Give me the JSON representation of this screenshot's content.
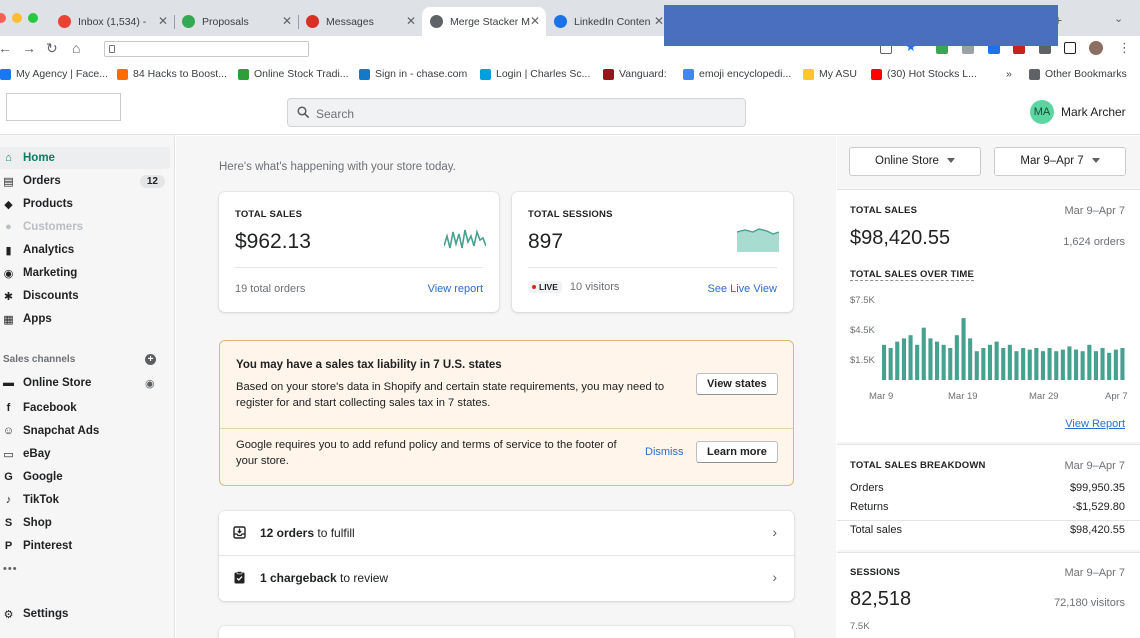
{
  "browser": {
    "tabs": [
      {
        "title": "Inbox (1,534) - ",
        "favicon_color": "#ea4335"
      },
      {
        "title": "Proposals",
        "favicon_color": "#34a853"
      },
      {
        "title": "Messages",
        "favicon_color": "#d93025"
      },
      {
        "title": "Merge Stacker M",
        "favicon_color": "#5f6368"
      },
      {
        "title": "LinkedIn Conten",
        "favicon_color": "#1a73e8"
      }
    ],
    "bookmarks": [
      {
        "label": "My Agency | Face...",
        "icon_color": "#1877f2"
      },
      {
        "label": "84 Hacks to Boost...",
        "icon_color": "#ff6b00"
      },
      {
        "label": "Online Stock Tradi...",
        "icon_color": "#2e9e3a"
      },
      {
        "label": "Sign in - chase.com",
        "icon_color": "#117aca"
      },
      {
        "label": "Login | Charles Sc...",
        "icon_color": "#00a0df"
      },
      {
        "label": "Vanguard:",
        "icon_color": "#96151d"
      },
      {
        "label": "emoji encyclopedi...",
        "icon_color": "#4285f4"
      },
      {
        "label": "My ASU",
        "icon_color": "#ffc627"
      },
      {
        "label": "(30) Hot Stocks L...",
        "icon_color": "#ff0000"
      },
      {
        "label": "Other Bookmarks",
        "icon_color": "#5f6368"
      }
    ],
    "overflow": "»"
  },
  "topbar": {
    "search_placeholder": "Search",
    "user_initials": "MA",
    "user_name": "Mark Archer"
  },
  "sidebar": {
    "items": [
      {
        "label": "Home",
        "icon": "home-icon",
        "glyph": "⌂"
      },
      {
        "label": "Orders",
        "icon": "orders-icon",
        "glyph": "▤",
        "count": "12"
      },
      {
        "label": "Products",
        "icon": "tag-icon",
        "glyph": "◆"
      },
      {
        "label": "Customers",
        "icon": "customer-icon",
        "glyph": "●"
      },
      {
        "label": "Analytics",
        "icon": "analytics-icon",
        "glyph": "▮"
      },
      {
        "label": "Marketing",
        "icon": "marketing-icon",
        "glyph": "◉"
      },
      {
        "label": "Discounts",
        "icon": "discount-icon",
        "glyph": "✱"
      },
      {
        "label": "Apps",
        "icon": "apps-icon",
        "glyph": "▦"
      }
    ],
    "channels_heading": "Sales channels",
    "channels": [
      {
        "label": "Online Store",
        "icon": "store-icon",
        "glyph": "▬"
      },
      {
        "label": "Facebook",
        "icon": "facebook-icon",
        "glyph": "f"
      },
      {
        "label": "Snapchat Ads",
        "icon": "snapchat-icon",
        "glyph": "☺"
      },
      {
        "label": "eBay",
        "icon": "ebay-icon",
        "glyph": "▭"
      },
      {
        "label": "Google",
        "icon": "google-icon",
        "glyph": "G"
      },
      {
        "label": "TikTok",
        "icon": "tiktok-icon",
        "glyph": "♪"
      },
      {
        "label": "Shop",
        "icon": "shop-icon",
        "glyph": "S"
      },
      {
        "label": "Pinterest",
        "icon": "pinterest-icon",
        "glyph": "P"
      }
    ],
    "more": "•••",
    "settings": "Settings"
  },
  "main": {
    "greeting": "Here's what's happening with your store today.",
    "sales_card": {
      "label": "TOTAL SALES",
      "value": "$962.13",
      "footer": "19 total orders",
      "link": "View report"
    },
    "sessions_card": {
      "label": "TOTAL SESSIONS",
      "value": "897",
      "live": "LIVE",
      "footer": "10 visitors",
      "link": "See Live View"
    },
    "tax_banner": {
      "title": "You may have a sales tax liability in 7 U.S. states",
      "body": "Based on your store's data in Shopify and certain state requirements, you may need to register for and start collecting sales tax in 7 states.",
      "button": "View states",
      "google_text": "Google requires you to add refund policy and terms of service to the footer of your store.",
      "dismiss": "Dismiss",
      "learn_more": "Learn more"
    },
    "tasks": [
      {
        "bold": "12 orders",
        "rest": " to fulfill"
      },
      {
        "bold": "1 chargeback",
        "rest": " to review"
      }
    ]
  },
  "right": {
    "channel_select": "Online Store",
    "date_select": "Mar 9–Apr 7",
    "total_sales": {
      "label": "TOTAL SALES",
      "date": "Mar 9–Apr 7",
      "value": "$98,420.55",
      "orders": "1,624 orders",
      "chart_title": "TOTAL SALES OVER TIME",
      "link": "View Report"
    },
    "breakdown": {
      "label": "TOTAL SALES BREAKDOWN",
      "date": "Mar 9–Apr 7",
      "rows": [
        {
          "label": "Orders",
          "value": "$99,950.35"
        },
        {
          "label": "Returns",
          "value": "-$1,529.80"
        },
        {
          "label": "Total sales",
          "value": "$98,420.55"
        }
      ]
    },
    "sessions": {
      "label": "SESSIONS",
      "date": "Mar 9–Apr 7",
      "value": "82,518",
      "visitors": "72,180 visitors",
      "tick": "7.5K"
    }
  },
  "chart_data": {
    "type": "bar",
    "title": "TOTAL SALES OVER TIME",
    "color": "#47a18f",
    "y_ticks": [
      "$7.5K",
      "$4.5K",
      "$1.5K"
    ],
    "ylim": [
      0,
      7500
    ],
    "x_ticks": [
      "Mar 9",
      "Mar 19",
      "Mar 29",
      "Apr 7"
    ],
    "values": [
      3300,
      3000,
      3600,
      3900,
      4200,
      3300,
      4900,
      3900,
      3600,
      3300,
      3000,
      4200,
      5800,
      3900,
      2700,
      3000,
      3300,
      3600,
      3000,
      3300,
      2700,
      3000,
      2850,
      3000,
      2700,
      3000,
      2700,
      2850,
      3150,
      2850,
      2700,
      3300,
      2700,
      3000,
      2550,
      2850,
      3000
    ]
  }
}
